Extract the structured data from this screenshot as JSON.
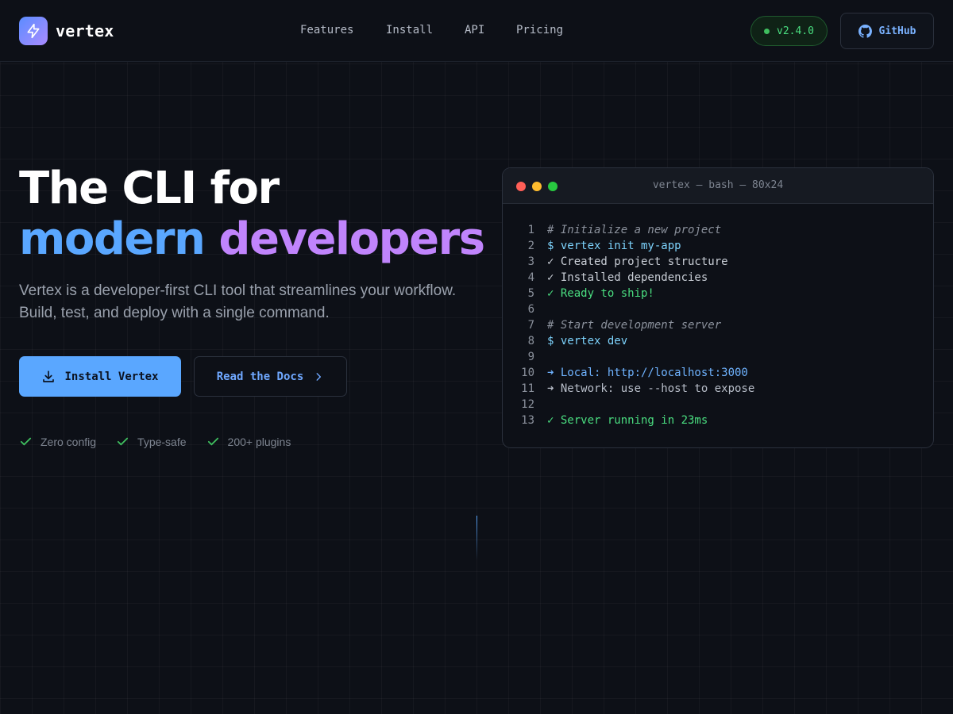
{
  "brand": {
    "name": "vertex",
    "logo_icon": "bolt-icon"
  },
  "nav": {
    "items": [
      {
        "label": "Features"
      },
      {
        "label": "Install"
      },
      {
        "label": "API"
      },
      {
        "label": "Pricing"
      }
    ]
  },
  "header": {
    "version": "v2.4.0",
    "github_label": "GitHub",
    "github_icon": "github-icon"
  },
  "hero": {
    "title_line1": "The CLI for",
    "title_word_a": "modern",
    "title_word_b": "developers",
    "subtitle": "Vertex is a developer-first CLI tool that streamlines your workflow. Build, test, and deploy with a single command.",
    "primary_cta": "Install Vertex",
    "secondary_cta": "Read the Docs",
    "features": [
      {
        "label": "Zero config"
      },
      {
        "label": "Type-safe"
      },
      {
        "label": "200+ plugins"
      }
    ]
  },
  "terminal": {
    "title": "vertex — bash — 80x24",
    "lines": [
      {
        "n": "1",
        "text": "# Initialize a new project",
        "kind": "comment"
      },
      {
        "n": "2",
        "text": "$ vertex init my-app",
        "kind": "cmd"
      },
      {
        "n": "3",
        "text": "✓ Created project structure",
        "kind": "plain"
      },
      {
        "n": "4",
        "text": "✓ Installed dependencies",
        "kind": "plain"
      },
      {
        "n": "5",
        "text": "✓ Ready to ship!",
        "kind": "success"
      },
      {
        "n": "6",
        "text": "",
        "kind": "plain"
      },
      {
        "n": "7",
        "text": "# Start development server",
        "kind": "comment"
      },
      {
        "n": "8",
        "text": "$ vertex dev",
        "kind": "cmd"
      },
      {
        "n": "9",
        "text": "",
        "kind": "plain"
      },
      {
        "n": "10",
        "text": "➜ Local: http://localhost:3000",
        "kind": "info"
      },
      {
        "n": "11",
        "text": "➜ Network: use --host to expose",
        "kind": "muted"
      },
      {
        "n": "12",
        "text": "",
        "kind": "plain"
      },
      {
        "n": "13",
        "text": "✓ Server running in 23ms",
        "kind": "success"
      }
    ]
  },
  "colors": {
    "background": "#0d1017",
    "accent_blue": "#5aa7ff",
    "accent_purple": "#c084fc",
    "success": "#4ade80"
  }
}
